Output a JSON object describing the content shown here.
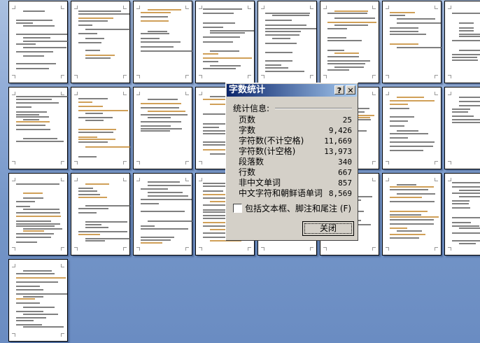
{
  "document": {
    "page_count_visible": 25
  },
  "dialog": {
    "title": "字数统计",
    "help_button": "?",
    "close_icon": "✕",
    "section_label": "统计信息:",
    "stats": [
      {
        "label": "页数",
        "value": "25"
      },
      {
        "label": "字数",
        "value": "9,426"
      },
      {
        "label": "字符数(不计空格)",
        "value": "11,669"
      },
      {
        "label": "字符数(计空格)",
        "value": "13,973"
      },
      {
        "label": "段落数",
        "value": "340"
      },
      {
        "label": "行数",
        "value": "667"
      },
      {
        "label": "非中文单词",
        "value": "857"
      },
      {
        "label": "中文字符和朝鲜语单词",
        "value": "8,569"
      }
    ],
    "checkbox_label": "包括文本框、脚注和尾注 (F)",
    "checkbox_checked": false,
    "close_button": "关闭"
  }
}
